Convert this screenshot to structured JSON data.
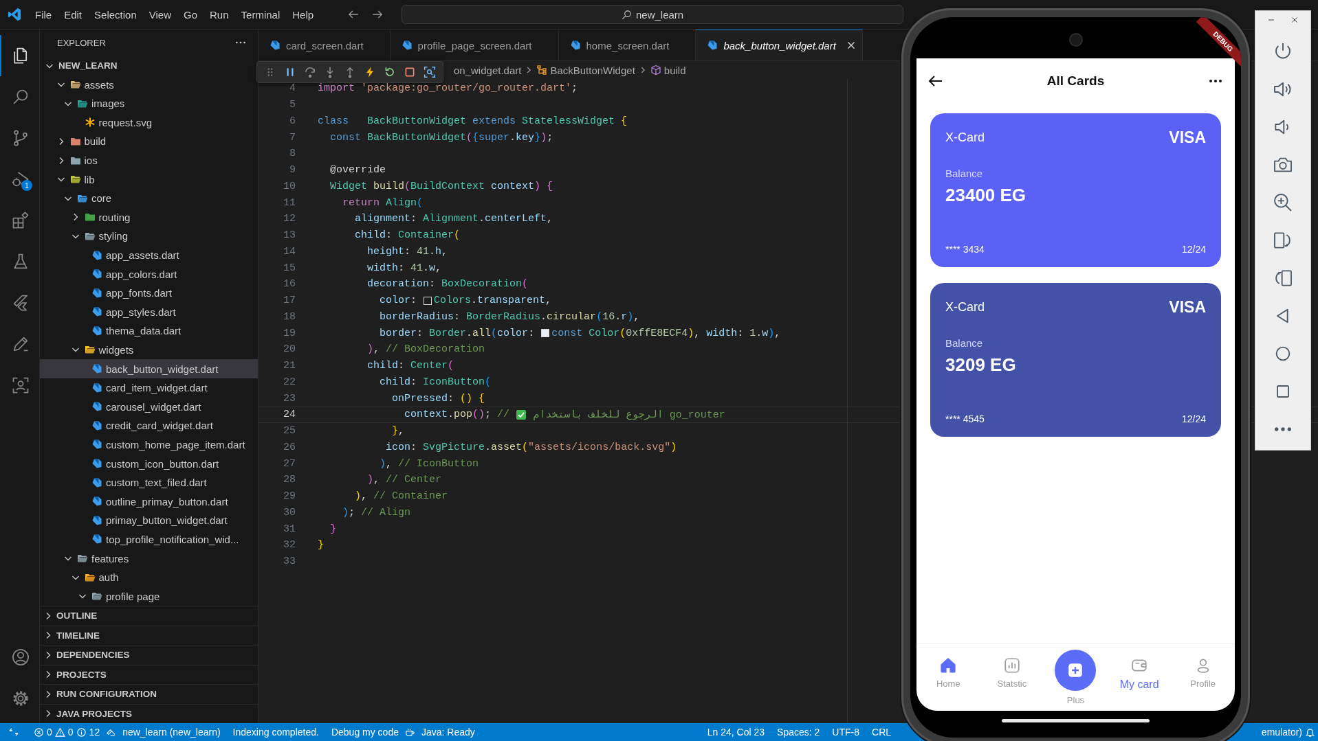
{
  "menu_bar": {
    "items": [
      "File",
      "Edit",
      "Selection",
      "View",
      "Go",
      "Run",
      "Terminal",
      "Help"
    ]
  },
  "command_center": {
    "text": "new_learn"
  },
  "activity_bar": {
    "top": [
      {
        "kind": "files",
        "selected": true
      },
      {
        "kind": "search",
        "selected": false
      },
      {
        "kind": "branch",
        "selected": false
      },
      {
        "kind": "debug",
        "selected": false,
        "badge": "1"
      },
      {
        "kind": "extensions",
        "selected": false
      },
      {
        "kind": "flask",
        "selected": false
      },
      {
        "kind": "flutter",
        "selected": false
      },
      {
        "kind": "pen",
        "selected": false
      },
      {
        "kind": "scan",
        "selected": false
      }
    ],
    "bottom": [
      {
        "kind": "account",
        "selected": false
      },
      {
        "kind": "gear",
        "selected": false
      }
    ]
  },
  "explorer": {
    "title": "EXPLORER",
    "root": "NEW_LEARN",
    "tree": [
      {
        "name": "assets",
        "kind": "folder",
        "color": "#dcb67a",
        "expanded": true,
        "selected": false,
        "children": [
          {
            "name": "images",
            "kind": "folder",
            "color": "#26a69a",
            "expanded": true,
            "selected": false,
            "children": [
              {
                "name": "request.svg",
                "kind": "svg",
                "selected": false
              }
            ]
          }
        ]
      },
      {
        "name": "build",
        "kind": "folder",
        "color": "#d9826f",
        "expanded": false,
        "selected": false
      },
      {
        "name": "ios",
        "kind": "folder",
        "color": "#90a4ae",
        "expanded": false,
        "selected": false
      },
      {
        "name": "lib",
        "kind": "folder",
        "color": "#c0ca33",
        "expanded": true,
        "selected": false,
        "children": [
          {
            "name": "core",
            "kind": "folder",
            "color": "#42a5f5",
            "expanded": true,
            "selected": false,
            "children": [
              {
                "name": "routing",
                "kind": "folder",
                "color": "#43a047",
                "expanded": false,
                "selected": false
              },
              {
                "name": "styling",
                "kind": "folder",
                "color": "#90a4ae",
                "expanded": true,
                "selected": false,
                "children": [
                  {
                    "name": "app_assets.dart",
                    "kind": "dart",
                    "selected": false
                  },
                  {
                    "name": "app_colors.dart",
                    "kind": "dart",
                    "selected": false
                  },
                  {
                    "name": "app_fonts.dart",
                    "kind": "dart",
                    "selected": false
                  },
                  {
                    "name": "app_styles.dart",
                    "kind": "dart",
                    "selected": false
                  },
                  {
                    "name": "thema_data.dart",
                    "kind": "dart",
                    "selected": false
                  }
                ]
              },
              {
                "name": "widgets",
                "kind": "folder",
                "color": "#fbc02d",
                "expanded": true,
                "selected": false,
                "children": [
                  {
                    "name": "back_button_widget.dart",
                    "kind": "dart",
                    "selected": true
                  },
                  {
                    "name": "card_item_widget.dart",
                    "kind": "dart",
                    "selected": false
                  },
                  {
                    "name": "carousel_widget.dart",
                    "kind": "dart",
                    "selected": false
                  },
                  {
                    "name": "credit_card_widget.dart",
                    "kind": "dart",
                    "selected": false
                  },
                  {
                    "name": "custom_home_page_item.dart",
                    "kind": "dart",
                    "selected": false
                  },
                  {
                    "name": "custom_icon_button.dart",
                    "kind": "dart",
                    "selected": false
                  },
                  {
                    "name": "custom_text_filed.dart",
                    "kind": "dart",
                    "selected": false
                  },
                  {
                    "name": "outline_primay_button.dart",
                    "kind": "dart",
                    "selected": false
                  },
                  {
                    "name": "primay_button_widget.dart",
                    "kind": "dart",
                    "selected": false
                  },
                  {
                    "name": "top_profile_notification_wid...",
                    "kind": "dart",
                    "selected": false
                  }
                ]
              }
            ]
          },
          {
            "name": "features",
            "kind": "folder",
            "color": "#90a4ae",
            "expanded": true,
            "selected": false,
            "children": [
              {
                "name": "auth",
                "kind": "folder",
                "color": "#ffa726",
                "expanded": true,
                "selected": false,
                "children": [
                  {
                    "name": "profile page",
                    "kind": "folder",
                    "color": "#90a4ae",
                    "expanded": true,
                    "selected": false
                  }
                ]
              }
            ]
          }
        ]
      }
    ],
    "sections": [
      "OUTLINE",
      "TIMELINE",
      "DEPENDENCIES",
      "PROJECTS",
      "RUN CONFIGURATION",
      "JAVA PROJECTS"
    ]
  },
  "tabs": [
    {
      "label": "card_screen.dart",
      "selected": false
    },
    {
      "label": "profile_page_screen.dart",
      "selected": false
    },
    {
      "label": "home_screen.dart",
      "selected": false
    },
    {
      "label": "back_button_widget.dart",
      "selected": true
    }
  ],
  "breadcrumb": [
    {
      "label": "on_widget.dart",
      "kind": "file"
    },
    {
      "label": "BackButtonWidget",
      "kind": "class"
    },
    {
      "label": "build",
      "kind": "method"
    }
  ],
  "debug_toolbar": [
    {
      "kind": "grip"
    },
    {
      "kind": "pause"
    },
    {
      "kind": "step-over"
    },
    {
      "kind": "step-into"
    },
    {
      "kind": "step-out"
    },
    {
      "kind": "hot-reload"
    },
    {
      "kind": "restart"
    },
    {
      "kind": "stop"
    },
    {
      "kind": "inspect"
    }
  ],
  "editor": {
    "lines": [
      {
        "number": "4",
        "current": false,
        "tokens": [
          {
            "kind": "ctl",
            "text": "import"
          },
          {
            "kind": "str",
            "text": " 'package:go_router/go_router.dart'"
          },
          {
            "kind": "plain",
            "text": ";"
          }
        ]
      },
      {
        "number": "5",
        "current": false
      },
      {
        "number": "6",
        "current": false,
        "tokens": [
          {
            "kind": "kw",
            "text": "class"
          },
          {
            "kind": "type",
            "text": "   BackButtonWidget"
          },
          {
            "kind": "kw",
            "text": " extends"
          },
          {
            "kind": "type",
            "text": " StatelessWidget"
          },
          {
            "kind": "b1",
            "text": " {"
          }
        ]
      },
      {
        "number": "7",
        "current": false,
        "tokens": [
          {
            "kind": "kw",
            "text": "  const"
          },
          {
            "kind": "type",
            "text": " BackButtonWidget"
          },
          {
            "kind": "b2",
            "text": "("
          },
          {
            "kind": "b3",
            "text": "{"
          },
          {
            "kind": "kw",
            "text": "super"
          },
          {
            "kind": "plain",
            "text": "."
          },
          {
            "kind": "prop",
            "text": "key"
          },
          {
            "kind": "b3",
            "text": "}"
          },
          {
            "kind": "b2",
            "text": ")"
          },
          {
            "kind": "plain",
            "text": ";"
          }
        ]
      },
      {
        "number": "8",
        "current": false
      },
      {
        "number": "9",
        "current": false,
        "tokens": [
          {
            "kind": "plain",
            "text": "  @override"
          }
        ]
      },
      {
        "number": "10",
        "current": false,
        "tokens": [
          {
            "kind": "type",
            "text": "  Widget"
          },
          {
            "kind": "fn",
            "text": " build"
          },
          {
            "kind": "b2",
            "text": "("
          },
          {
            "kind": "type",
            "text": "BuildContext"
          },
          {
            "kind": "prop",
            "text": " context"
          },
          {
            "kind": "b2",
            "text": ")"
          },
          {
            "kind": "b2",
            "text": " {"
          }
        ]
      },
      {
        "number": "11",
        "current": false,
        "tokens": [
          {
            "kind": "ctl",
            "text": "    return"
          },
          {
            "kind": "type",
            "text": " Align"
          },
          {
            "kind": "b3",
            "text": "("
          }
        ]
      },
      {
        "number": "12",
        "current": false,
        "tokens": [
          {
            "kind": "prop",
            "text": "      alignment"
          },
          {
            "kind": "plain",
            "text": ": "
          },
          {
            "kind": "type",
            "text": "Alignment"
          },
          {
            "kind": "plain",
            "text": "."
          },
          {
            "kind": "prop",
            "text": "centerLeft"
          },
          {
            "kind": "plain",
            "text": ","
          }
        ]
      },
      {
        "number": "13",
        "current": false,
        "tokens": [
          {
            "kind": "prop",
            "text": "      child"
          },
          {
            "kind": "plain",
            "text": ": "
          },
          {
            "kind": "type",
            "text": "Container"
          },
          {
            "kind": "b1",
            "text": "("
          }
        ]
      },
      {
        "number": "14",
        "current": false,
        "tokens": [
          {
            "kind": "prop",
            "text": "        height"
          },
          {
            "kind": "plain",
            "text": ": "
          },
          {
            "kind": "num",
            "text": "41"
          },
          {
            "kind": "plain",
            "text": "."
          },
          {
            "kind": "prop",
            "text": "h"
          },
          {
            "kind": "plain",
            "text": ","
          }
        ]
      },
      {
        "number": "15",
        "current": false,
        "tokens": [
          {
            "kind": "prop",
            "text": "        width"
          },
          {
            "kind": "plain",
            "text": ": "
          },
          {
            "kind": "num",
            "text": "41"
          },
          {
            "kind": "plain",
            "text": "."
          },
          {
            "kind": "prop",
            "text": "w"
          },
          {
            "kind": "plain",
            "text": ","
          }
        ]
      },
      {
        "number": "16",
        "current": false,
        "tokens": [
          {
            "kind": "prop",
            "text": "        decoration"
          },
          {
            "kind": "plain",
            "text": ": "
          },
          {
            "kind": "type",
            "text": "BoxDecoration"
          },
          {
            "kind": "b2",
            "text": "("
          }
        ]
      },
      {
        "number": "17",
        "current": false,
        "tokens": [
          {
            "kind": "prop",
            "text": "          color"
          },
          {
            "kind": "plain",
            "text": ": "
          },
          {
            "kind": "swatch"
          },
          {
            "kind": "type",
            "text": "Colors"
          },
          {
            "kind": "plain",
            "text": "."
          },
          {
            "kind": "prop",
            "text": "transparent"
          },
          {
            "kind": "plain",
            "text": ","
          }
        ]
      },
      {
        "number": "18",
        "current": false,
        "tokens": [
          {
            "kind": "prop",
            "text": "          borderRadius"
          },
          {
            "kind": "plain",
            "text": ": "
          },
          {
            "kind": "type",
            "text": "BorderRadius"
          },
          {
            "kind": "plain",
            "text": "."
          },
          {
            "kind": "fn",
            "text": "circular"
          },
          {
            "kind": "b3",
            "text": "("
          },
          {
            "kind": "num",
            "text": "16"
          },
          {
            "kind": "plain",
            "text": "."
          },
          {
            "kind": "prop",
            "text": "r"
          },
          {
            "kind": "b3",
            "text": ")"
          },
          {
            "kind": "plain",
            "text": ","
          }
        ]
      },
      {
        "number": "19",
        "current": false,
        "tokens": [
          {
            "kind": "prop",
            "text": "          border"
          },
          {
            "kind": "plain",
            "text": ": "
          },
          {
            "kind": "type",
            "text": "Border"
          },
          {
            "kind": "plain",
            "text": "."
          },
          {
            "kind": "fn",
            "text": "all"
          },
          {
            "kind": "b3",
            "text": "("
          },
          {
            "kind": "prop",
            "text": "color"
          },
          {
            "kind": "plain",
            "text": ": "
          },
          {
            "kind": "swatch",
            "color": "#e8ecf4"
          },
          {
            "kind": "kw",
            "text": "const"
          },
          {
            "kind": "type",
            "text": " Color"
          },
          {
            "kind": "b1",
            "text": "("
          },
          {
            "kind": "num",
            "text": "0xffE8ECF4"
          },
          {
            "kind": "b1",
            "text": ")"
          },
          {
            "kind": "plain",
            "text": ", "
          },
          {
            "kind": "prop",
            "text": "width"
          },
          {
            "kind": "plain",
            "text": ": "
          },
          {
            "kind": "num",
            "text": "1"
          },
          {
            "kind": "plain",
            "text": "."
          },
          {
            "kind": "prop",
            "text": "w"
          },
          {
            "kind": "b3",
            "text": ")"
          },
          {
            "kind": "plain",
            "text": ","
          }
        ]
      },
      {
        "number": "20",
        "current": false,
        "tokens": [
          {
            "kind": "b2",
            "text": "        )"
          },
          {
            "kind": "plain",
            "text": ", "
          },
          {
            "kind": "cmt",
            "text": "// BoxDecoration"
          }
        ]
      },
      {
        "number": "21",
        "current": false,
        "tokens": [
          {
            "kind": "prop",
            "text": "        child"
          },
          {
            "kind": "plain",
            "text": ": "
          },
          {
            "kind": "type",
            "text": "Center"
          },
          {
            "kind": "b2",
            "text": "("
          }
        ]
      },
      {
        "number": "22",
        "current": false,
        "tokens": [
          {
            "kind": "prop",
            "text": "          child"
          },
          {
            "kind": "plain",
            "text": ": "
          },
          {
            "kind": "type",
            "text": "IconButton"
          },
          {
            "kind": "b3",
            "text": "("
          }
        ]
      },
      {
        "number": "23",
        "current": false,
        "tokens": [
          {
            "kind": "prop",
            "text": "            onPressed"
          },
          {
            "kind": "plain",
            "text": ": "
          },
          {
            "kind": "b1",
            "text": "()"
          },
          {
            "kind": "b1",
            "text": " {"
          }
        ]
      },
      {
        "number": "24",
        "current": true,
        "tokens": [
          {
            "kind": "prop",
            "text": "              context"
          },
          {
            "kind": "plain",
            "text": "."
          },
          {
            "kind": "fn",
            "text": "pop"
          },
          {
            "kind": "b2",
            "text": "()"
          },
          {
            "kind": "plain",
            "text": ";"
          },
          {
            "kind": "cmt",
            "text": " // "
          },
          {
            "kind": "check"
          },
          {
            "kind": "cmt",
            "text": " الرجوع للخلف باستخدام go_router"
          }
        ]
      },
      {
        "number": "25",
        "current": false,
        "tokens": [
          {
            "kind": "b1",
            "text": "            }"
          },
          {
            "kind": "plain",
            "text": ","
          }
        ]
      },
      {
        "number": "26",
        "current": false,
        "tokens": [
          {
            "kind": "prop",
            "text": "           icon"
          },
          {
            "kind": "plain",
            "text": ": "
          },
          {
            "kind": "type",
            "text": "SvgPicture"
          },
          {
            "kind": "plain",
            "text": "."
          },
          {
            "kind": "fn",
            "text": "asset"
          },
          {
            "kind": "b1",
            "text": "("
          },
          {
            "kind": "str",
            "text": "\"assets/icons/back.svg\""
          },
          {
            "kind": "b1",
            "text": ")"
          }
        ]
      },
      {
        "number": "27",
        "current": false,
        "tokens": [
          {
            "kind": "b3",
            "text": "          )"
          },
          {
            "kind": "plain",
            "text": ", "
          },
          {
            "kind": "cmt",
            "text": "// IconButton"
          }
        ]
      },
      {
        "number": "28",
        "current": false,
        "tokens": [
          {
            "kind": "b2",
            "text": "        )"
          },
          {
            "kind": "plain",
            "text": ", "
          },
          {
            "kind": "cmt",
            "text": "// Center"
          }
        ]
      },
      {
        "number": "29",
        "current": false,
        "tokens": [
          {
            "kind": "b1",
            "text": "      )"
          },
          {
            "kind": "plain",
            "text": ", "
          },
          {
            "kind": "cmt",
            "text": "// Container"
          }
        ]
      },
      {
        "number": "30",
        "current": false,
        "tokens": [
          {
            "kind": "b3",
            "text": "    )"
          },
          {
            "kind": "plain",
            "text": "; "
          },
          {
            "kind": "cmt",
            "text": "// Align"
          }
        ]
      },
      {
        "number": "31",
        "current": false,
        "tokens": [
          {
            "kind": "b2",
            "text": "  }"
          }
        ]
      },
      {
        "number": "32",
        "current": false,
        "tokens": [
          {
            "kind": "b1",
            "text": "}"
          }
        ]
      },
      {
        "number": "33",
        "current": false
      }
    ]
  },
  "status_bar": {
    "problems": {
      "errors": "0",
      "warnings": "0",
      "infos": "12"
    },
    "left": [
      {
        "kind": "project",
        "text": "new_learn (new_learn)"
      },
      {
        "kind": "text",
        "text": "Indexing completed."
      },
      {
        "kind": "text",
        "text": "Debug my code"
      },
      {
        "kind": "java",
        "text": "Java: Ready"
      }
    ],
    "right": [
      "Ln 24, Col 23",
      "Spaces: 2",
      "UTF-8",
      "CRL"
    ],
    "device": "emulator)"
  },
  "phone": {
    "debug_banner": "DEBUG",
    "app": {
      "title": "All Cards",
      "cards": [
        {
          "name": "X-Card",
          "brand": "VISA",
          "balance_label": "Balance",
          "balance": "23400 EG",
          "number": "**** 3434",
          "expiry": "12/24",
          "color": "#5b61f4"
        },
        {
          "name": "X-Card",
          "brand": "VISA",
          "balance_label": "Balance",
          "balance": "3209 EG",
          "number": "**** 4545",
          "expiry": "12/24",
          "color": "#4351a6"
        }
      ],
      "nav": [
        {
          "label": "Home",
          "kind": "home",
          "icon_active": true,
          "label_active": false
        },
        {
          "label": "Statstic",
          "kind": "chart",
          "icon_active": false,
          "label_active": false
        },
        {
          "label": "Plus",
          "kind": "plus",
          "icon_active": true,
          "label_active": false
        },
        {
          "label": "My card",
          "kind": "wallet",
          "icon_active": false,
          "label_active": true
        },
        {
          "label": "Profile",
          "kind": "person",
          "icon_active": false,
          "label_active": false
        }
      ]
    }
  },
  "emulator_panel": {
    "buttons": [
      {
        "kind": "power"
      },
      {
        "kind": "volume-up"
      },
      {
        "kind": "volume-down"
      },
      {
        "kind": "camera"
      },
      {
        "kind": "zoom"
      },
      {
        "kind": "rotate-right"
      },
      {
        "kind": "rotate-left"
      },
      {
        "kind": "back"
      },
      {
        "kind": "home"
      },
      {
        "kind": "overview"
      },
      {
        "kind": "more"
      }
    ]
  }
}
